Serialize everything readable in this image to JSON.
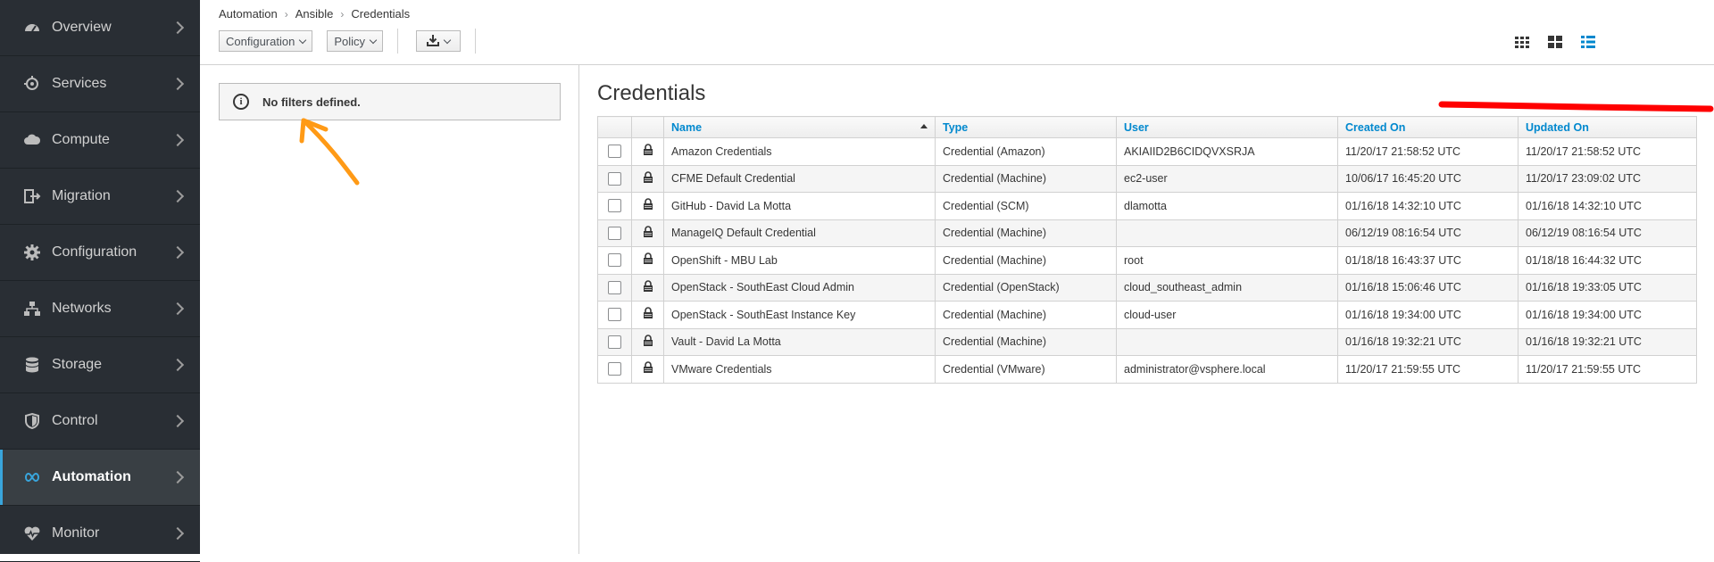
{
  "sidebar": {
    "items": [
      {
        "label": "Overview",
        "icon": "dashboard-icon"
      },
      {
        "label": "Services",
        "icon": "services-icon"
      },
      {
        "label": "Compute",
        "icon": "cloud-icon"
      },
      {
        "label": "Migration",
        "icon": "migration-icon"
      },
      {
        "label": "Configuration",
        "icon": "gear-icon"
      },
      {
        "label": "Networks",
        "icon": "network-icon"
      },
      {
        "label": "Storage",
        "icon": "database-icon"
      },
      {
        "label": "Control",
        "icon": "shield-icon"
      },
      {
        "label": "Automation",
        "icon": "automation-icon",
        "active": true
      },
      {
        "label": "Monitor",
        "icon": "heartbeat-icon"
      }
    ]
  },
  "breadcrumb": [
    "Automation",
    "Ansible",
    "Credentials"
  ],
  "toolbar": {
    "configuration_label": "Configuration",
    "policy_label": "Policy",
    "download_icon": "download-icon"
  },
  "views": [
    "grid-view-icon",
    "tile-view-icon",
    "list-view-icon"
  ],
  "filter": {
    "text": "No filters defined."
  },
  "main": {
    "title": "Credentials",
    "columns": [
      "Name",
      "Type",
      "User",
      "Created On",
      "Updated On"
    ],
    "rows": [
      {
        "name": "Amazon Credentials",
        "type": "Credential (Amazon)",
        "user": "AKIAIID2B6CIDQVXSRJA",
        "created": "11/20/17 21:58:52 UTC",
        "updated": "11/20/17 21:58:52 UTC"
      },
      {
        "name": "CFME Default Credential",
        "type": "Credential (Machine)",
        "user": "ec2-user",
        "created": "10/06/17 16:45:20 UTC",
        "updated": "11/20/17 23:09:02 UTC"
      },
      {
        "name": "GitHub - David La Motta",
        "type": "Credential (SCM)",
        "user": "dlamotta",
        "created": "01/16/18 14:32:10 UTC",
        "updated": "01/16/18 14:32:10 UTC"
      },
      {
        "name": "ManageIQ Default Credential",
        "type": "Credential (Machine)",
        "user": "",
        "created": "06/12/19 08:16:54 UTC",
        "updated": "06/12/19 08:16:54 UTC"
      },
      {
        "name": "OpenShift - MBU Lab",
        "type": "Credential (Machine)",
        "user": "root",
        "created": "01/18/18 16:43:37 UTC",
        "updated": "01/18/18 16:44:32 UTC"
      },
      {
        "name": "OpenStack - SouthEast Cloud Admin",
        "type": "Credential (OpenStack)",
        "user": "cloud_southeast_admin",
        "created": "01/16/18 15:06:46 UTC",
        "updated": "01/16/18 19:33:05 UTC"
      },
      {
        "name": "OpenStack - SouthEast Instance Key",
        "type": "Credential (Machine)",
        "user": "cloud-user",
        "created": "01/16/18 19:34:00 UTC",
        "updated": "01/16/18 19:34:00 UTC"
      },
      {
        "name": "Vault - David La Motta",
        "type": "Credential (Machine)",
        "user": "",
        "created": "01/16/18 19:32:21 UTC",
        "updated": "01/16/18 19:32:21 UTC"
      },
      {
        "name": "VMware Credentials",
        "type": "Credential (VMware)",
        "user": "administrator@vsphere.local",
        "created": "11/20/17 21:59:55 UTC",
        "updated": "11/20/17 21:59:55 UTC"
      }
    ]
  },
  "colors": {
    "sidebar_bg": "#292e34",
    "link_blue": "#0088ce",
    "active_accent": "#39a5dc",
    "annotation_red": "#ff0000",
    "annotation_orange": "#ff9a16"
  }
}
